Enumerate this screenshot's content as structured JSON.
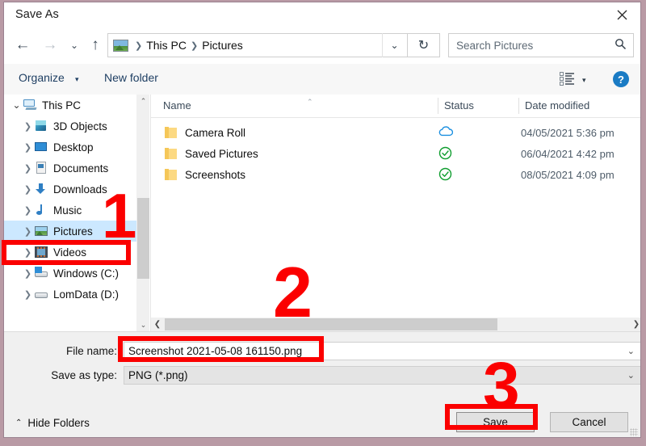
{
  "window": {
    "title": "Save As",
    "close_icon": "close-icon"
  },
  "nav": {
    "back_icon": "←",
    "forward_icon": "→",
    "recent_icon": "⌄",
    "up_icon": "↑",
    "refresh_icon": "↻",
    "dropdown_icon": "⌄"
  },
  "address": {
    "crumbs": [
      "This PC",
      "Pictures"
    ],
    "separator": "❯"
  },
  "search": {
    "placeholder": "Search Pictures",
    "icon": "search-icon"
  },
  "commandbar": {
    "organize_label": "Organize",
    "organize_caret": "▾",
    "new_folder_label": "New folder",
    "view_caret": "▾",
    "help_label": "?"
  },
  "sidebar": {
    "items": [
      {
        "label": "This PC",
        "twisty": "⌄",
        "icon": "this-pc-icon",
        "indent": false,
        "selected": false
      },
      {
        "label": "3D Objects",
        "twisty": "❯",
        "icon": "3d-objects-icon",
        "indent": true,
        "selected": false
      },
      {
        "label": "Desktop",
        "twisty": "❯",
        "icon": "desktop-icon",
        "indent": true,
        "selected": false
      },
      {
        "label": "Documents",
        "twisty": "❯",
        "icon": "documents-icon",
        "indent": true,
        "selected": false
      },
      {
        "label": "Downloads",
        "twisty": "❯",
        "icon": "downloads-icon",
        "indent": true,
        "selected": false
      },
      {
        "label": "Music",
        "twisty": "❯",
        "icon": "music-icon",
        "indent": true,
        "selected": false
      },
      {
        "label": "Pictures",
        "twisty": "❯",
        "icon": "pictures-icon",
        "indent": true,
        "selected": true
      },
      {
        "label": "Videos",
        "twisty": "❯",
        "icon": "videos-icon",
        "indent": true,
        "selected": false
      },
      {
        "label": "Windows (C:)",
        "twisty": "❯",
        "icon": "drive-icon",
        "indent": true,
        "selected": false
      },
      {
        "label": "LomData (D:)",
        "twisty": "❯",
        "icon": "drive-icon",
        "indent": true,
        "selected": false
      }
    ],
    "scroll_up_icon": "⌃",
    "scroll_down_icon": "⌄"
  },
  "filelist": {
    "columns": [
      "Name",
      "Status",
      "Date modified"
    ],
    "sort_indicator": "⌃",
    "rows": [
      {
        "name": "Camera Roll",
        "status": "cloud-icon",
        "date": "04/05/2021 5:36 pm"
      },
      {
        "name": "Saved Pictures",
        "status": "check-circle-icon",
        "date": "06/04/2021 4:42 pm"
      },
      {
        "name": "Screenshots",
        "status": "check-circle-icon",
        "date": "08/05/2021 4:09 pm"
      }
    ],
    "scroll_left_icon": "❮",
    "scroll_right_icon": "❯"
  },
  "form": {
    "filename_label": "File name:",
    "filename_value": "Screenshot 2021-05-08 161150.png",
    "savetype_label": "Save as type:",
    "savetype_value": "PNG (*.png)",
    "dropdown_caret": "⌄"
  },
  "footer": {
    "hide_folders_label": "Hide Folders",
    "hide_folders_caret": "⌃",
    "save_label": "Save",
    "cancel_label": "Cancel"
  },
  "annotations": {
    "step1": "1",
    "step2": "2",
    "step3": "3",
    "color": "#fb0000"
  }
}
